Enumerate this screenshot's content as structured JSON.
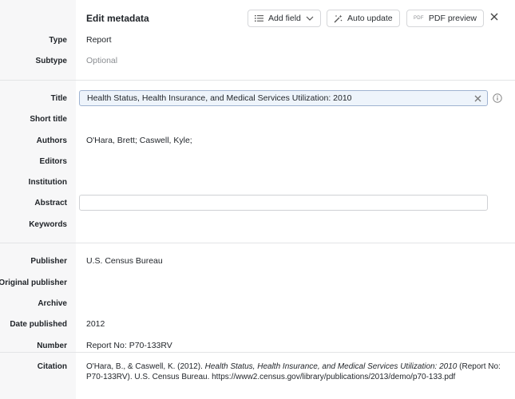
{
  "header": {
    "title": "Edit metadata",
    "add_field": "Add field",
    "auto_update": "Auto update",
    "pdf_mini": "PDF",
    "pdf_preview": "PDF preview"
  },
  "icons": {
    "add_field": "list-icon",
    "auto_update": "magic-wand-icon",
    "dropdown": "chevron-down-icon",
    "close": "close-icon",
    "clear": "clear-icon",
    "info": "info-icon"
  },
  "fields": {
    "type": {
      "label": "Type",
      "value": "Report"
    },
    "subtype": {
      "label": "Subtype",
      "placeholder": "Optional"
    },
    "title": {
      "label": "Title",
      "value": "Health Status, Health Insurance, and Medical Services Utilization: 2010"
    },
    "short_title": {
      "label": "Short title",
      "value": ""
    },
    "authors": {
      "label": "Authors",
      "value": "O'Hara, Brett; Caswell, Kyle;"
    },
    "editors": {
      "label": "Editors",
      "value": ""
    },
    "institution": {
      "label": "Institution",
      "value": ""
    },
    "abstract": {
      "label": "Abstract",
      "value": ""
    },
    "keywords": {
      "label": "Keywords",
      "value": ""
    },
    "publisher": {
      "label": "Publisher",
      "value": "U.S. Census Bureau"
    },
    "original_publisher": {
      "label": "Original publisher",
      "value": ""
    },
    "archive": {
      "label": "Archive",
      "value": ""
    },
    "date_published": {
      "label": "Date published",
      "value": "2012"
    },
    "number": {
      "label": "Number",
      "value": "Report No: P70-133RV"
    },
    "citation": {
      "label": "Citation",
      "prefix": "O'Hara, B., & Caswell, K. (2012). ",
      "italic": "Health Status, Health Insurance, and Medical Services Utilization: 2010",
      "suffix": " (Report No: P70-133RV). U.S. Census Bureau. https://www2.census.gov/library/publications/2013/demo/p70-133.pdf"
    }
  }
}
